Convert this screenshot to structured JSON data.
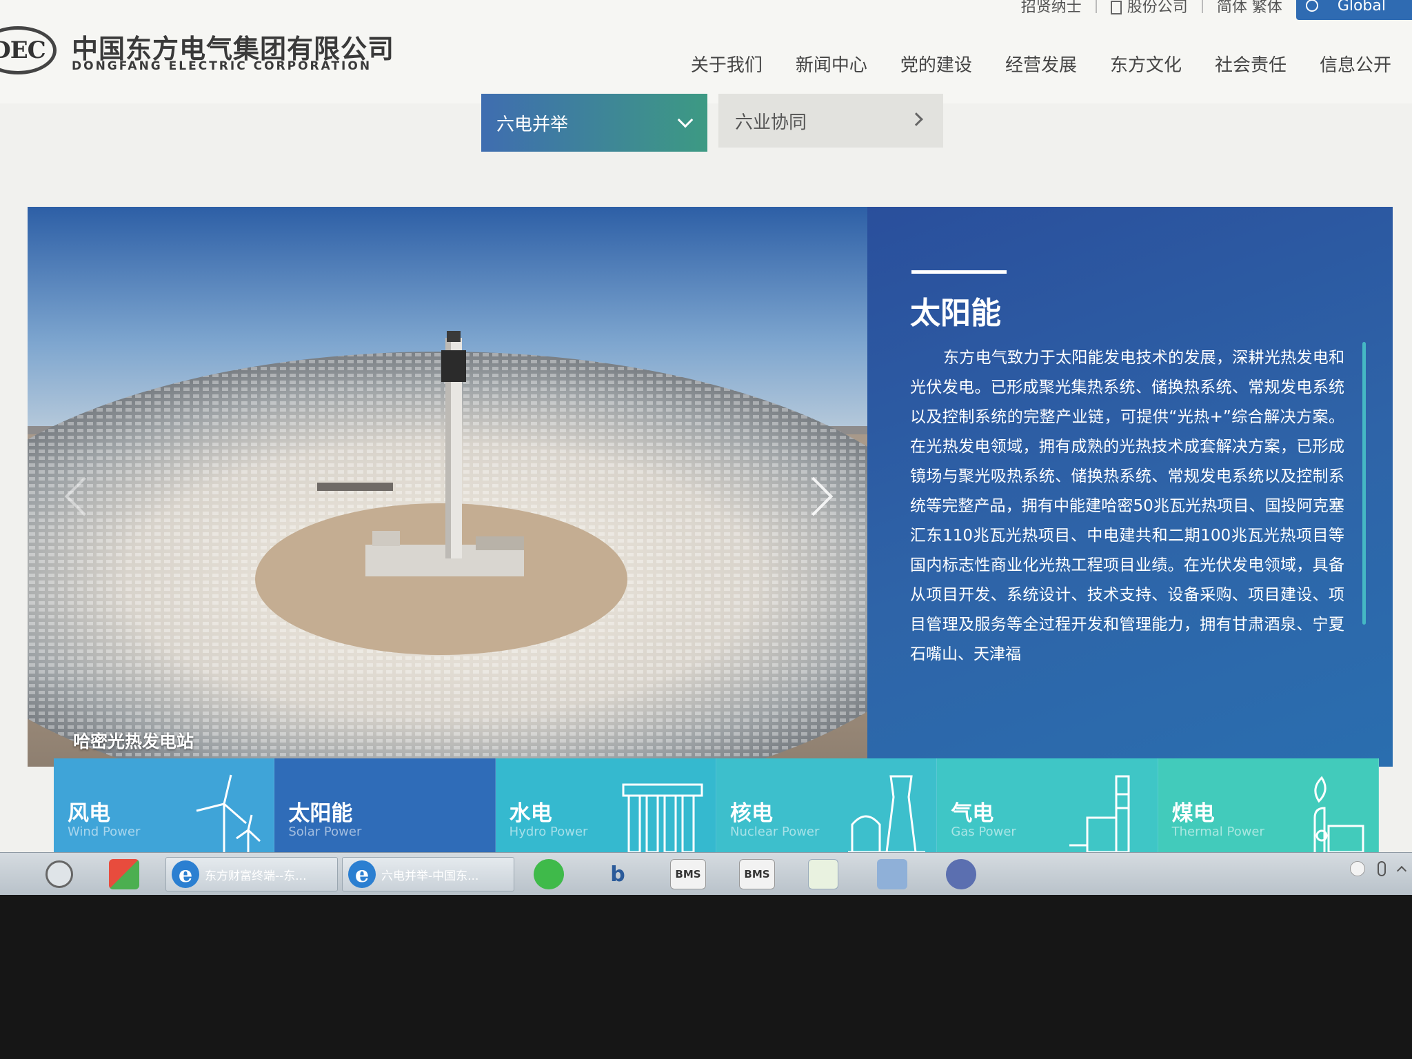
{
  "header": {
    "logo_mark": "DEC",
    "logo_cn": "中国东方电气集团有限公司",
    "logo_en": "DONGFANG ELECTRIC CORPORATION",
    "top_links": [
      "招贤纳士",
      "股份公司",
      "简体 繁体"
    ],
    "global_label": "Global",
    "nav": [
      "关于我们",
      "新闻中心",
      "党的建设",
      "经营发展",
      "东方文化",
      "社会责任",
      "信息公开"
    ]
  },
  "subnav": {
    "active": "六电并举",
    "other": "六业协同"
  },
  "banner": {
    "photo_caption": "哈密光热发电站",
    "title": "太阳能",
    "body": "东方电气致力于太阳能发电技术的发展，深耕光热发电和光伏发电。已形成聚光集热系统、储换热系统、常规发电系统以及控制系统的完整产业链，可提供“光热+”综合解决方案。在光热发电领域，拥有成熟的光热技术成套解决方案，已形成镜场与聚光吸热系统、储换热系统、常规发电系统以及控制系统等完整产品，拥有中能建哈密50兆瓦光热项目、国投阿克塞汇东110兆瓦光热项目、中电建共和二期100兆瓦光热项目等国内标志性商业化光热工程项目业绩。在光伏发电领域，具备从项目开发、系统设计、技术支持、设备采购、项目建设、项目管理及服务等全过程开发和管理能力，拥有甘肃酒泉、宁夏石嘴山、天津福"
  },
  "categories": [
    {
      "cn": "风电",
      "en": "Wind Power",
      "icon": "wind-turbine-icon"
    },
    {
      "cn": "太阳能",
      "en": "Solar Power",
      "icon": "solar-icon"
    },
    {
      "cn": "水电",
      "en": "Hydro Power",
      "icon": "dam-icon"
    },
    {
      "cn": "核电",
      "en": "Nuclear Power",
      "icon": "nuclear-plant-icon"
    },
    {
      "cn": "气电",
      "en": "Gas Power",
      "icon": "gas-plant-icon"
    },
    {
      "cn": "煤电",
      "en": "Thermal Power",
      "icon": "thermal-plant-icon"
    }
  ],
  "taskbar": {
    "tasks": [
      "东方财富终端--东...",
      "六电并举-中国东..."
    ],
    "icons": [
      "webcam-icon",
      "apps-icon",
      "wechat-icon",
      "bq-icon",
      "BMS",
      "BMS",
      "frog-icon",
      "network-icon",
      "ibi-icon"
    ]
  },
  "colors": {
    "accent_blue": "#2f6cb8",
    "info_panel": "#2a5aa3",
    "teal": "#3dbfcc"
  }
}
